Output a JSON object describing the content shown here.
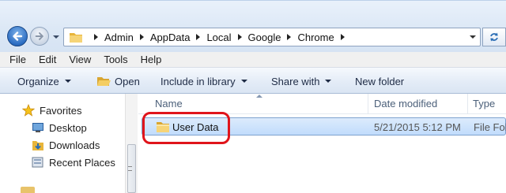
{
  "address_bar": {
    "crumbs": [
      "Admin",
      "AppData",
      "Local",
      "Google",
      "Chrome"
    ]
  },
  "menu": {
    "items": [
      "File",
      "Edit",
      "View",
      "Tools",
      "Help"
    ]
  },
  "command_bar": {
    "organize": "Organize",
    "open": "Open",
    "include": "Include in library",
    "share": "Share with",
    "new_folder": "New folder"
  },
  "nav_pane": {
    "favorites": "Favorites",
    "items": [
      "Desktop",
      "Downloads",
      "Recent Places"
    ]
  },
  "columns": {
    "name": "Name",
    "date": "Date modified",
    "type": "Type"
  },
  "files": [
    {
      "name": "User Data",
      "date": "5/21/2015 5:12 PM",
      "type": "File Fol"
    }
  ],
  "colors": {
    "highlight": "#e0141b",
    "selection": "#c1dcfc"
  }
}
